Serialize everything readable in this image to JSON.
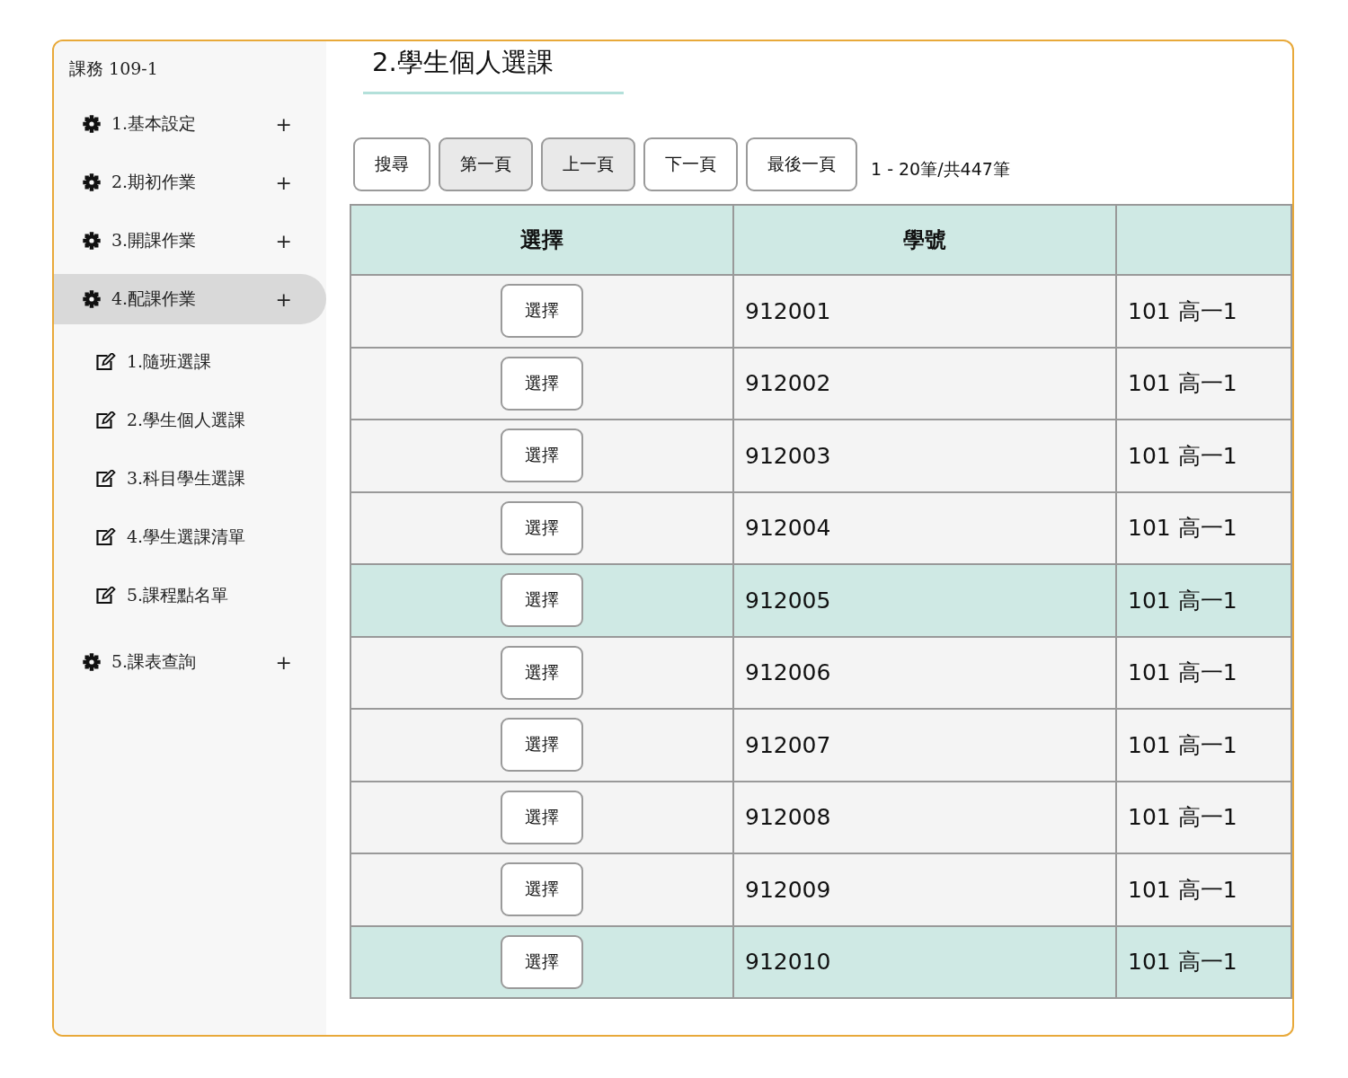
{
  "sidebar": {
    "title": "課務 109-1",
    "items": [
      {
        "label": "1.基本設定",
        "toggle": "+",
        "selected": false
      },
      {
        "label": "2.期初作業",
        "toggle": "+",
        "selected": false
      },
      {
        "label": "3.開課作業",
        "toggle": "+",
        "selected": false
      },
      {
        "label": "4.配課作業",
        "toggle": "+",
        "selected": true,
        "expanded": true,
        "children": [
          {
            "label": "1.隨班選課"
          },
          {
            "label": "2.學生個人選課"
          },
          {
            "label": "3.科目學生選課"
          },
          {
            "label": "4.學生選課清單"
          },
          {
            "label": "5.課程點名單"
          }
        ]
      },
      {
        "label": "5.課表查詢",
        "toggle": "+",
        "selected": false
      }
    ]
  },
  "page_title": "2.學生個人選課",
  "toolbar": {
    "buttons": [
      {
        "label": "搜尋",
        "disabled": false
      },
      {
        "label": "第一頁",
        "disabled": true
      },
      {
        "label": "上一頁",
        "disabled": true
      },
      {
        "label": "下一頁",
        "disabled": false
      },
      {
        "label": "最後一頁",
        "disabled": false
      }
    ],
    "record_count": "1 - 20筆/共447筆"
  },
  "table": {
    "columns": [
      "選擇",
      "學號"
    ],
    "rows": [
      {
        "action": "選擇",
        "student_id": "912001",
        "column_3": "101 高一1",
        "highlighted": false
      },
      {
        "action": "選擇",
        "student_id": "912002",
        "column_3": "101 高一1",
        "highlighted": false
      },
      {
        "action": "選擇",
        "student_id": "912003",
        "column_3": "101 高一1",
        "highlighted": false
      },
      {
        "action": "選擇",
        "student_id": "912004",
        "column_3": "101 高一1",
        "highlighted": false
      },
      {
        "action": "選擇",
        "student_id": "912005",
        "column_3": "101 高一1",
        "highlighted": true
      },
      {
        "action": "選擇",
        "student_id": "912006",
        "column_3": "101 高一1",
        "highlighted": false
      },
      {
        "action": "選擇",
        "student_id": "912007",
        "column_3": "101 高一1",
        "highlighted": false
      },
      {
        "action": "選擇",
        "student_id": "912008",
        "column_3": "101 高一1",
        "highlighted": false
      },
      {
        "action": "選擇",
        "student_id": "912009",
        "column_3": "101 高一1",
        "highlighted": false
      },
      {
        "action": "選擇",
        "student_id": "912010",
        "column_3": "101 高一1",
        "highlighted": true
      }
    ]
  }
}
